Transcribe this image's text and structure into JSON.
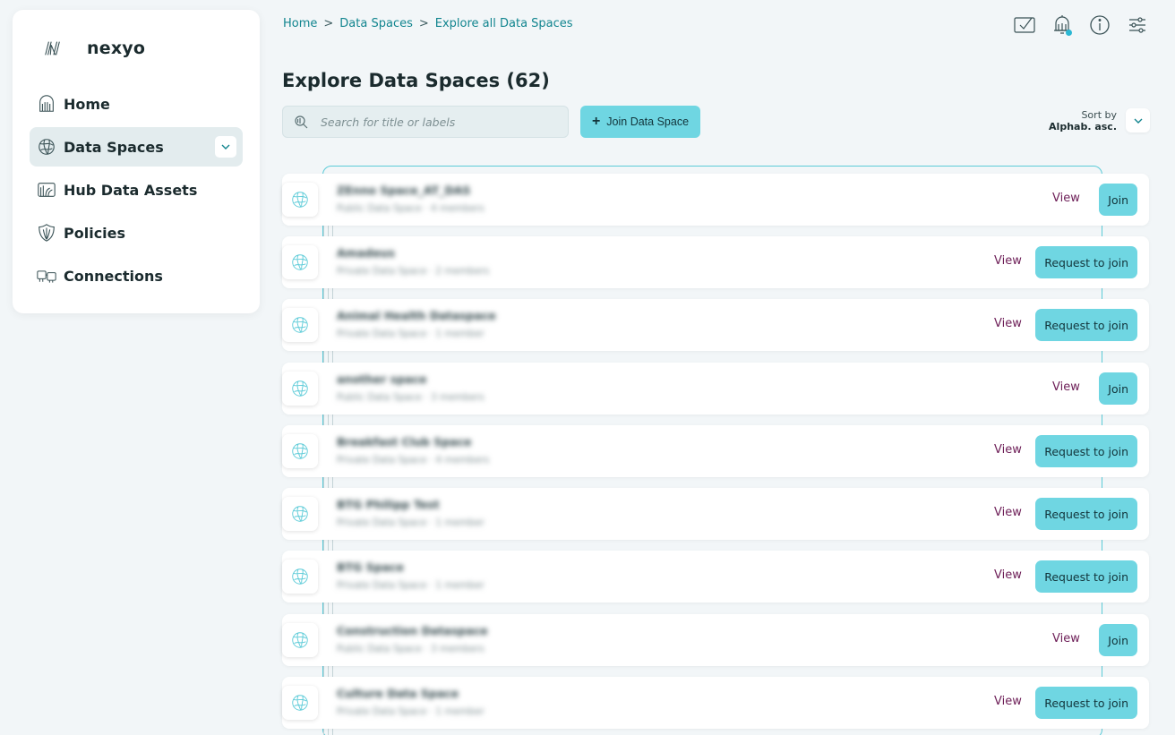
{
  "brand": {
    "name": "nexyo"
  },
  "sidebar": {
    "items": [
      {
        "label": "Home",
        "icon": "home-icon"
      },
      {
        "label": "Data Spaces",
        "icon": "globe-icon",
        "active": true
      },
      {
        "label": "Hub Data Assets",
        "icon": "data-assets-icon"
      },
      {
        "label": "Policies",
        "icon": "shield-icon"
      },
      {
        "label": "Connections",
        "icon": "connections-icon"
      }
    ]
  },
  "breadcrumb": {
    "home": "Home",
    "spaces": "Data Spaces",
    "current": "Explore all Data Spaces",
    "separator": ">"
  },
  "header": {
    "title": "Explore Data Spaces (62)"
  },
  "search": {
    "placeholder": "Search for title or labels"
  },
  "join_button": {
    "label": "Join Data Space"
  },
  "sort": {
    "label": "Sort by",
    "value": "Alphab. asc."
  },
  "list": {
    "view_label": "View",
    "rows": [
      {
        "title": "ZEnno Space_AT_DAS",
        "subtitle": "Public Data Space · 4 members",
        "action": "Join"
      },
      {
        "title": "Amadeus",
        "subtitle": "Private Data Space · 2 members",
        "action": "Request to join"
      },
      {
        "title": "Animal Health Dataspace",
        "subtitle": "Private Data Space · 1 member",
        "action": "Request to join"
      },
      {
        "title": "another space",
        "subtitle": "Public Data Space · 3 members",
        "action": "Join"
      },
      {
        "title": "Breakfast Club Space",
        "subtitle": "Private Data Space · 4 members",
        "action": "Request to join"
      },
      {
        "title": "BTG Philipp Test",
        "subtitle": "Private Data Space · 1 member",
        "action": "Request to join"
      },
      {
        "title": "BTG Space",
        "subtitle": "Private Data Space · 1 member",
        "action": "Request to join"
      },
      {
        "title": "Construction Dataspace",
        "subtitle": "Public Data Space · 3 members",
        "action": "Join"
      },
      {
        "title": "Culture Data Space",
        "subtitle": "Private Data Space · 1 member",
        "action": "Request to join"
      }
    ]
  },
  "colors": {
    "accent": "#6fd6e2",
    "link": "#12858f",
    "view": "#6d1e57",
    "notification": "#2bb7d3"
  }
}
